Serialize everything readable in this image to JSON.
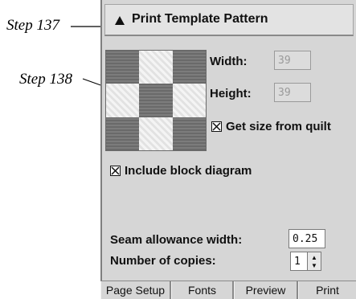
{
  "callouts": {
    "step137": "Step 137",
    "step138": "Step 138"
  },
  "dialog": {
    "title": "Print Template Pattern",
    "width_label": "Width:",
    "width_value": "39",
    "height_label": "Height:",
    "height_value": "39",
    "get_size_label": "Get size from quilt",
    "get_size_checked": true,
    "include_block_label": "Include block diagram",
    "include_block_checked": true,
    "seam_label": "Seam allowance width:",
    "seam_value": "0.25",
    "copies_label": "Number of copies:",
    "copies_value": "1"
  },
  "tabs": [
    "Page Setup",
    "Fonts",
    "Preview",
    "Print"
  ],
  "pattern": [
    "dark",
    "light",
    "dark",
    "light",
    "dark",
    "light",
    "dark",
    "light",
    "dark"
  ],
  "colors": {
    "panel": "#d6d6d6",
    "title_bar": "#e3e3e3",
    "disabled_text": "#9a9a9a"
  }
}
